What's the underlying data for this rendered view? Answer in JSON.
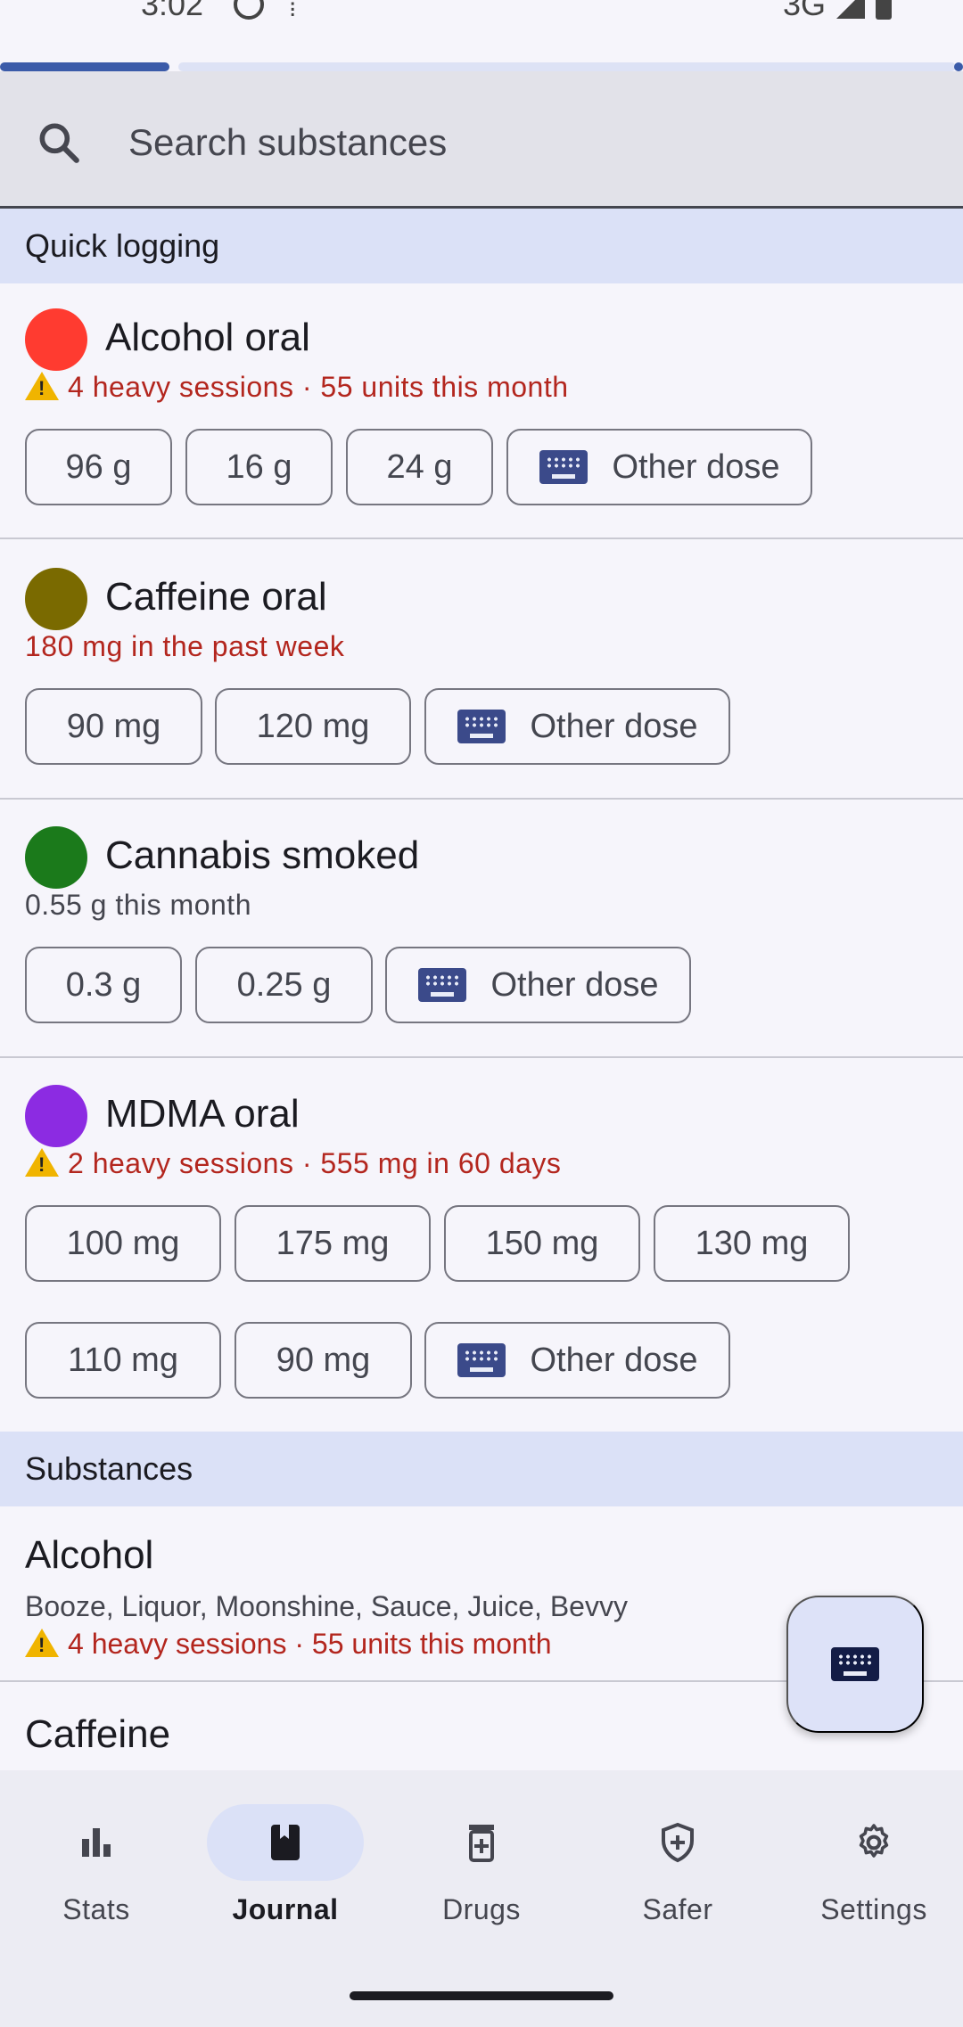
{
  "status_bar": {
    "time": "3:02",
    "network": "3G"
  },
  "search": {
    "placeholder": "Search substances"
  },
  "sections": {
    "quick_logging": "Quick logging",
    "substances": "Substances"
  },
  "quick_logging": [
    {
      "name": "Alcohol oral",
      "color": "#ff3b30",
      "summary": "4 heavy sessions · 55 units this month",
      "warning": true,
      "doses": [
        "96 g",
        "16 g",
        "24 g"
      ],
      "other": "Other dose"
    },
    {
      "name": "Caffeine oral",
      "color": "#7a6a00",
      "summary": "180 mg in the past week",
      "warning": false,
      "summary_style": "warn",
      "doses": [
        "90 mg",
        "120 mg"
      ],
      "other": "Other dose"
    },
    {
      "name": "Cannabis smoked",
      "color": "#1b7a1b",
      "summary": "0.55 g this month",
      "warning": false,
      "summary_style": "muted",
      "doses": [
        "0.3 g",
        "0.25 g"
      ],
      "other": "Other dose"
    },
    {
      "name": "MDMA oral",
      "color": "#8c2be2",
      "summary": "2 heavy sessions · 555 mg in 60 days",
      "warning": true,
      "doses": [
        "100 mg",
        "175 mg",
        "150 mg",
        "130 mg",
        "110 mg",
        "90 mg"
      ],
      "other": "Other dose"
    }
  ],
  "substances": [
    {
      "name": "Alcohol",
      "aliases": "Booze, Liquor, Moonshine, Sauce, Juice, Bevvy",
      "summary": "4 heavy sessions · 55 units this month"
    },
    {
      "name": "Caffeine"
    }
  ],
  "fab": {
    "icon": "keyboard-icon"
  },
  "nav": [
    {
      "label": "Stats",
      "icon": "bar-chart-icon",
      "active": false
    },
    {
      "label": "Journal",
      "icon": "book-icon",
      "active": true
    },
    {
      "label": "Drugs",
      "icon": "pill-bottle-icon",
      "active": false
    },
    {
      "label": "Safer",
      "icon": "shield-icon",
      "active": false
    },
    {
      "label": "Settings",
      "icon": "gear-icon",
      "active": false
    }
  ]
}
